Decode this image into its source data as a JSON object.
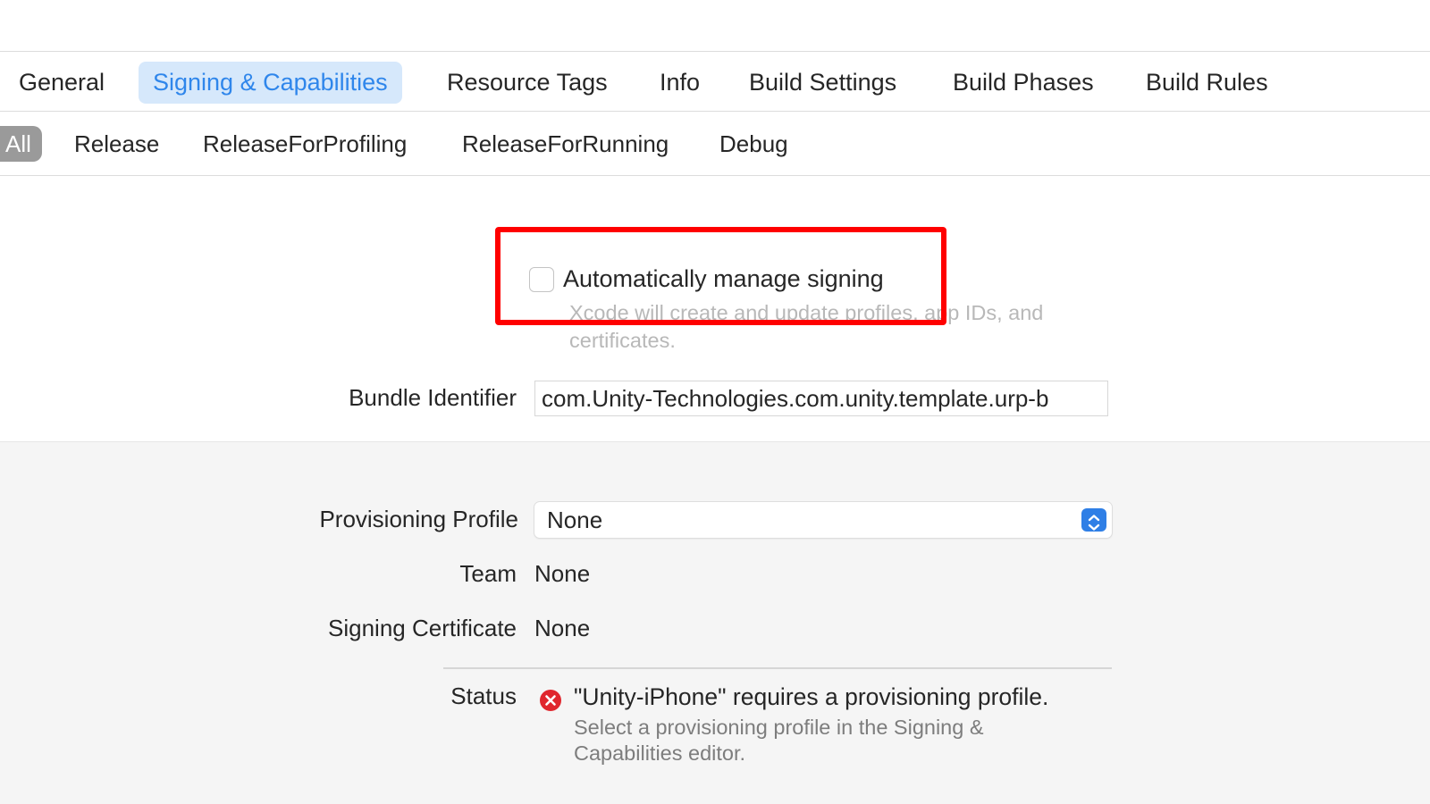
{
  "tabs": [
    {
      "label": "General"
    },
    {
      "label": "Signing & Capabilities"
    },
    {
      "label": "Resource Tags"
    },
    {
      "label": "Info"
    },
    {
      "label": "Build Settings"
    },
    {
      "label": "Build Phases"
    },
    {
      "label": "Build Rules"
    }
  ],
  "active_tab": "Signing & Capabilities",
  "configs": [
    {
      "label": "All"
    },
    {
      "label": "Release"
    },
    {
      "label": "ReleaseForProfiling"
    },
    {
      "label": "ReleaseForRunning"
    },
    {
      "label": "Debug"
    }
  ],
  "active_config": "All",
  "signing": {
    "auto_manage_label": "Automatically manage signing",
    "auto_manage_checked": false,
    "auto_manage_desc": "Xcode will create and update profiles, app IDs, and certificates.",
    "bundle_identifier_label": "Bundle Identifier",
    "bundle_identifier_value": "com.Unity-Technologies.com.unity.template.urp-b",
    "provisioning_profile_label": "Provisioning Profile",
    "provisioning_profile_value": "None",
    "team_label": "Team",
    "team_value": "None",
    "signing_certificate_label": "Signing Certificate",
    "signing_certificate_value": "None",
    "status_label": "Status",
    "status_title": "\"Unity-iPhone\" requires a provisioning profile.",
    "status_desc": "Select a provisioning profile in the Signing & Capabilities editor."
  },
  "icons": {
    "status": "error-circle-x-icon",
    "select": "chevron-up-down-icon"
  },
  "colors": {
    "accent": "#2f86eb",
    "active_tab_bg": "#d6e8fb",
    "error": "#e0262d",
    "highlight": "#ff0000"
  }
}
